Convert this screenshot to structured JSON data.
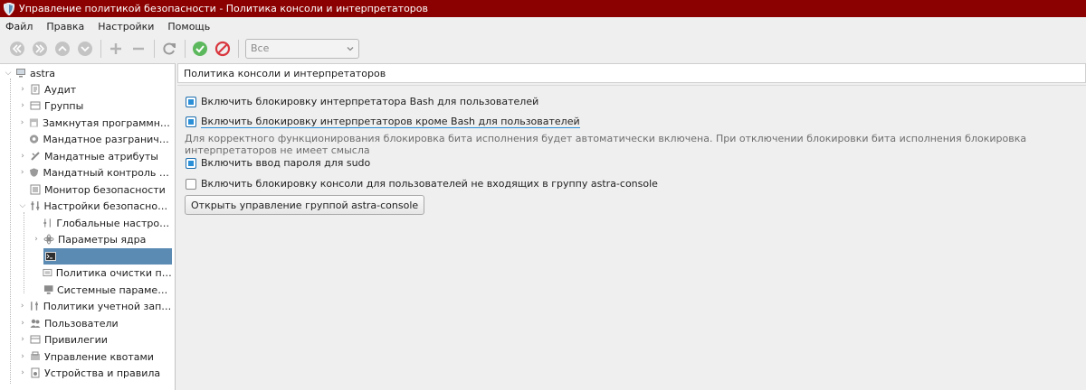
{
  "window": {
    "title": "Управление политикой безопасности - Политика консоли и интерпретаторов",
    "accent_color": "#8b0000"
  },
  "menu": [
    "Файл",
    "Правка",
    "Настройки",
    "Помощь"
  ],
  "toolbar": {
    "icons": [
      "back-icon",
      "forward-icon",
      "up-icon",
      "down-icon",
      "add-icon",
      "remove-icon",
      "refresh-icon",
      "apply-icon",
      "cancel-icon"
    ],
    "filter_value": "Все"
  },
  "sidebar": {
    "root": "astra",
    "items": [
      {
        "label": "Аудит",
        "icon": "audit-icon"
      },
      {
        "label": "Группы",
        "icon": "groups-icon"
      },
      {
        "label": "Замкнутая программная ...",
        "icon": "closed-software-icon"
      },
      {
        "label": "Мандатное разграничен...",
        "icon": "mandatory-access-icon"
      },
      {
        "label": "Мандатные атрибуты",
        "icon": "mandatory-attributes-icon"
      },
      {
        "label": "Мандатный контроль це...",
        "icon": "integrity-control-icon"
      },
      {
        "label": "Монитор безопасности",
        "icon": "security-monitor-icon"
      },
      {
        "label": "Настройки безопасности",
        "icon": "security-settings-icon"
      },
      {
        "label": "Глобальные настройк...",
        "icon": "global-settings-icon"
      },
      {
        "label": "Параметры ядра",
        "icon": "kernel-params-icon"
      },
      {
        "label": "",
        "icon": "console-icon"
      },
      {
        "label": "Политика очистки пам...",
        "icon": "memory-cleanup-icon"
      },
      {
        "label": "Системные параметры",
        "icon": "system-params-icon"
      },
      {
        "label": "Политики учетной записи",
        "icon": "account-policy-icon"
      },
      {
        "label": "Пользователи",
        "icon": "users-icon"
      },
      {
        "label": "Привилегии",
        "icon": "privileges-icon"
      },
      {
        "label": "Управление квотами",
        "icon": "quotas-icon"
      },
      {
        "label": "Устройства и правила",
        "icon": "devices-icon"
      }
    ],
    "selected_color": "#5b8ab3"
  },
  "content": {
    "header": "Политика консоли и интерпретаторов",
    "opt_bash": "Включить блокировку интерпретатора Bash для пользователей",
    "opt_others": "Включить блокировку интерпретаторов кроме Bash для пользователей",
    "note": "Для корректного функционирования блокировка бита исполнения будет автоматически включена. При отключении блокировки бита исполнения блокировка интерпретаторов не имеет смысла",
    "opt_sudo": "Включить ввод пароля для sudo",
    "opt_console": "Включить блокировку консоли для пользователей не входящих в группу astra-console",
    "open_button": "Открыть управление группой astra-console"
  }
}
